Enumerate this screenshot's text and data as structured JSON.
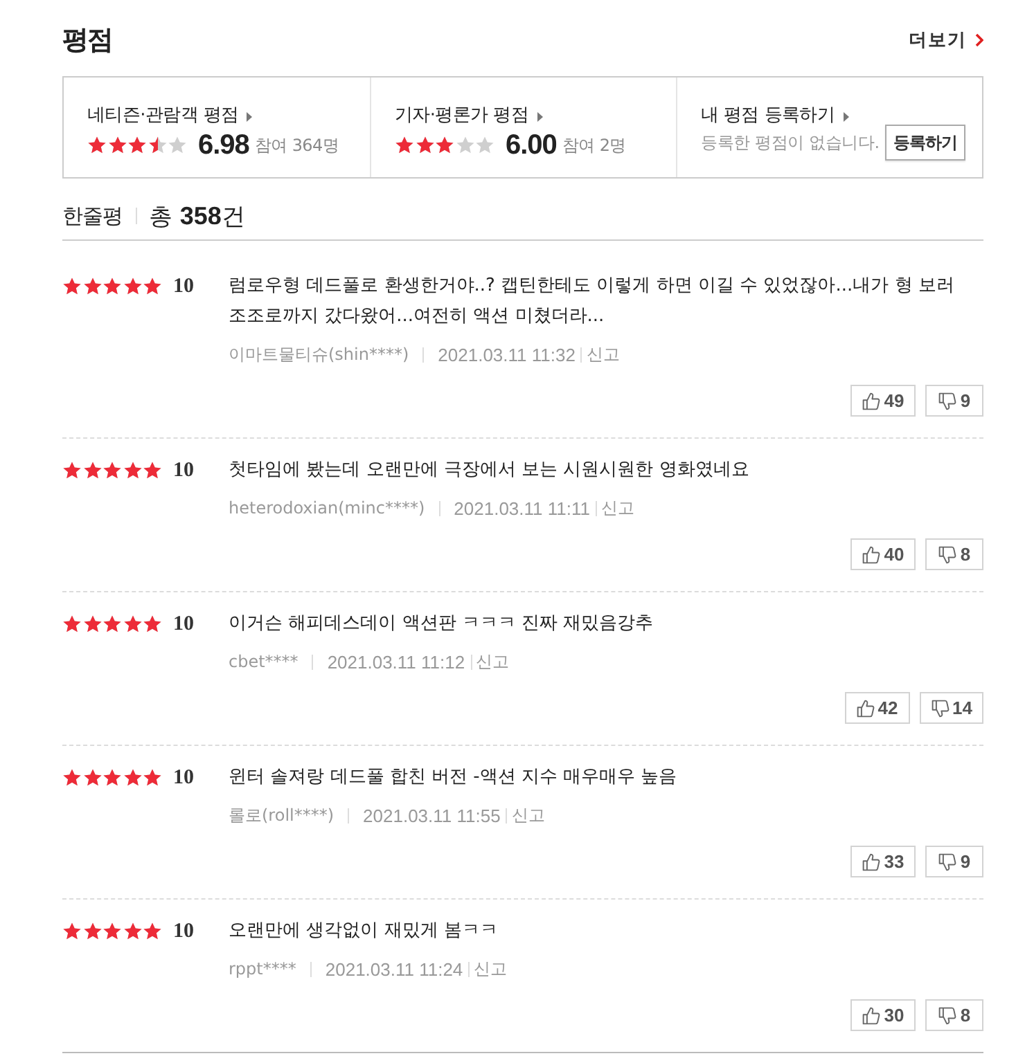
{
  "header": {
    "title": "평점",
    "more_link": "더보기"
  },
  "summary": [
    {
      "kind": "score",
      "label": "네티즌·관람객 평점",
      "stars": 3.5,
      "score": "6.98",
      "participants": "참여 364명"
    },
    {
      "kind": "score",
      "label": "기자·평론가 평점",
      "stars": 3,
      "score": "6.00",
      "participants": "참여 2명"
    },
    {
      "kind": "register",
      "label": "내 평점 등록하기",
      "message": "등록한 평점이 없습니다.",
      "button": "등록하기"
    }
  ],
  "reviews_header": {
    "title": "한줄평",
    "total": "총 **358**건"
  },
  "reviews": [
    {
      "stars": 5,
      "score": "10",
      "text": "럼로우형 데드풀로 환생한거야..? 캡틴한테도 이렇게 하면 이길 수 있었잖아...내가 형 보러 조조로까지 갔다왔어...여전히 액션 미쳤더라...",
      "author": "이마트물티슈(shin****)",
      "date": "2021.03.11 11:32",
      "report": "신고",
      "likes": "49",
      "dislikes": "9"
    },
    {
      "stars": 5,
      "score": "10",
      "text": "첫타임에 봤는데 오랜만에 극장에서 보는 시원시원한 영화였네요",
      "author": "heterodoxian(minc****)",
      "date": "2021.03.11 11:11",
      "report": "신고",
      "likes": "40",
      "dislikes": "8"
    },
    {
      "stars": 5,
      "score": "10",
      "text": "이거슨 해피데스데이 액션판 ㅋㅋㅋ 진짜 재밌음강추",
      "author": "cbet****",
      "date": "2021.03.11 11:12",
      "report": "신고",
      "likes": "42",
      "dislikes": "14"
    },
    {
      "stars": 5,
      "score": "10",
      "text": "윈터 솔져랑 데드풀 합친 버전 -액션 지수 매우매우 높음",
      "author": "롤로(roll****)",
      "date": "2021.03.11 11:55",
      "report": "신고",
      "likes": "33",
      "dislikes": "9"
    },
    {
      "stars": 5,
      "score": "10",
      "text": "오랜만에 생각없이 재밌게 봄ㅋㅋ",
      "author": "rppt****",
      "date": "2021.03.11 11:24",
      "report": "신고",
      "likes": "30",
      "dislikes": "8"
    }
  ]
}
